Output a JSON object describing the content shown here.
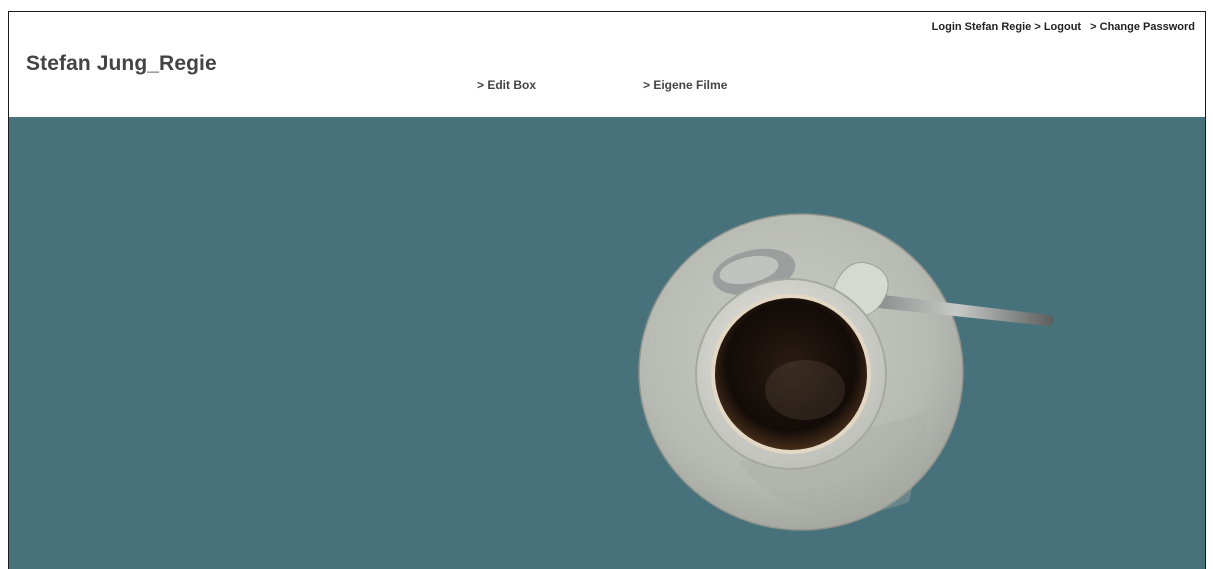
{
  "header": {
    "title": "Stefan Jung_Regie",
    "nav": [
      {
        "label": "> Edit Box"
      },
      {
        "label": "> Eigene Filme"
      }
    ],
    "account": {
      "login": "Login Stefan Regie",
      "logout": "> Logout",
      "change_password": "> Change Password"
    }
  },
  "stage": {
    "background_color": "#47727b",
    "image": "coffee-cup-on-saucer"
  }
}
